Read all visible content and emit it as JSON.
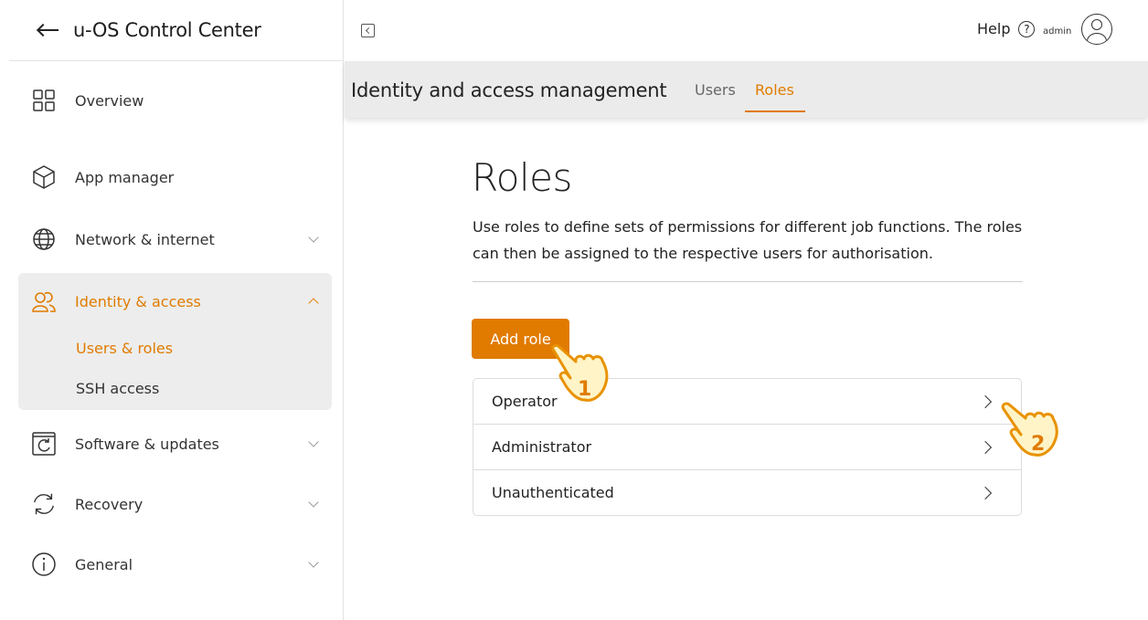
{
  "sidebar": {
    "app_title": "u-OS Control Center",
    "items": [
      {
        "label": "Overview",
        "icon": "grid-icon"
      },
      {
        "label": "App manager",
        "icon": "cube-icon"
      },
      {
        "label": "Network & internet",
        "icon": "globe-icon"
      },
      {
        "label": "Identity & access",
        "icon": "users-icon"
      },
      {
        "label": "Software & updates",
        "icon": "refresh-box-icon"
      },
      {
        "label": "Recovery",
        "icon": "recovery-icon"
      },
      {
        "label": "General",
        "icon": "info-icon"
      }
    ],
    "sub_items": [
      "Users & roles",
      "SSH access"
    ]
  },
  "topbar": {
    "help_label": "Help",
    "help_symbol": "?",
    "user_label": "admin"
  },
  "subheader": {
    "title": "Identity and access management",
    "tabs": [
      "Users",
      "Roles"
    ],
    "active_tab": "Roles"
  },
  "main": {
    "title": "Roles",
    "description": "Use roles to define sets of permissions for different job functions. The roles can then be assigned to the respective users for authorisation.",
    "add_button": "Add role",
    "roles": [
      "Operator",
      "Administrator",
      "Unauthenticated"
    ]
  },
  "annotations": [
    "1",
    "2"
  ],
  "colors": {
    "accent": "#e07b00",
    "hand_fill": "#fff4c8",
    "hand_outline": "#e89200"
  }
}
